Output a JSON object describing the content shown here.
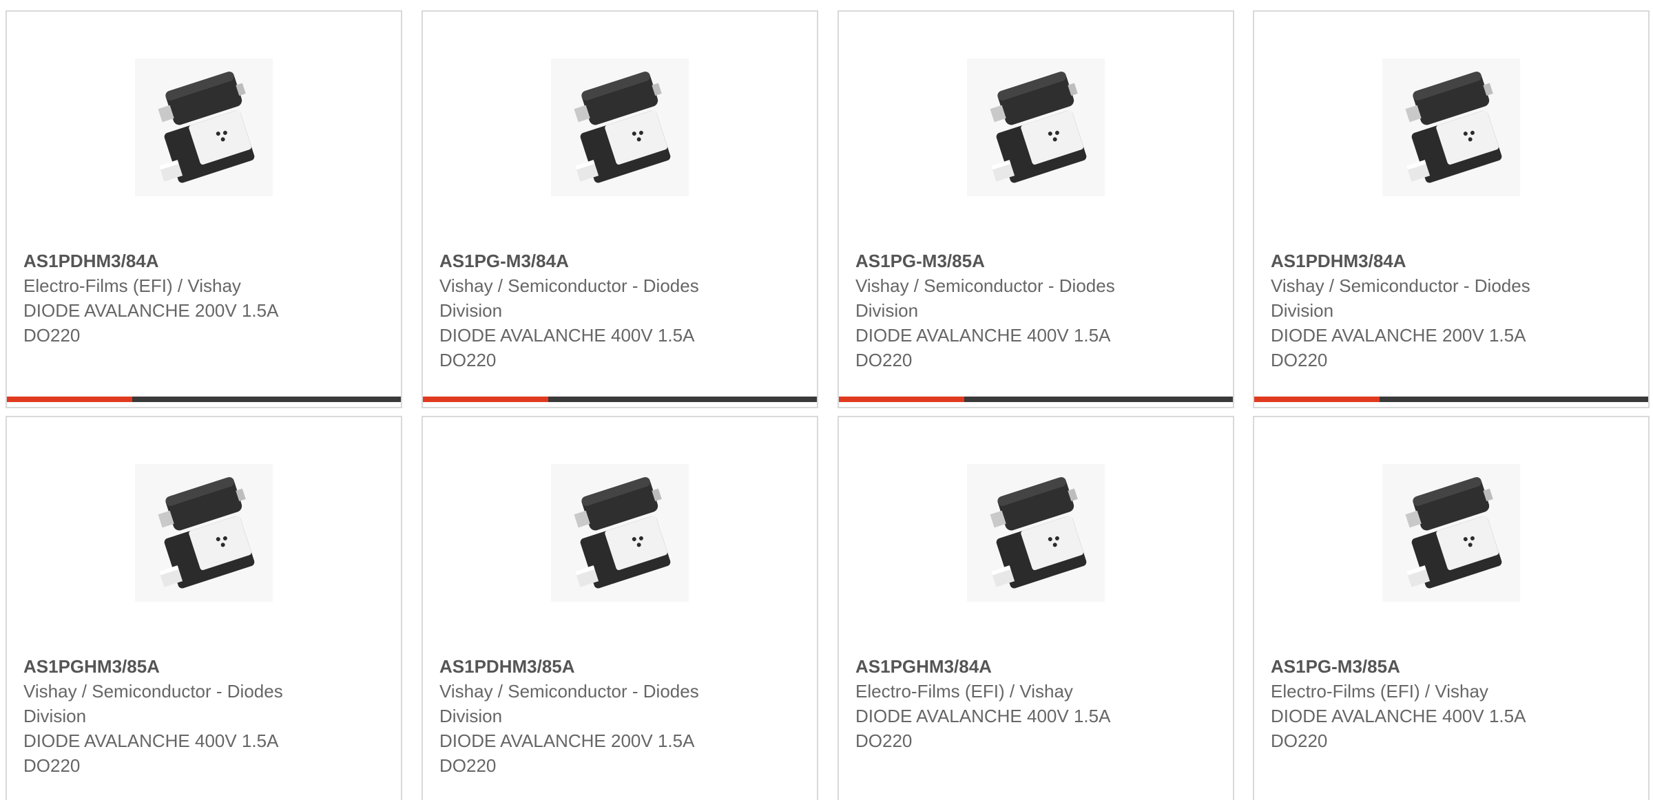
{
  "colors": {
    "accent": "#e03a1e",
    "bar": "#3a3a3a",
    "border": "#d9d9d9",
    "text": "#666666"
  },
  "products": [
    {
      "part_number": "AS1PDHM3/84A",
      "manufacturer": "Electro-Films (EFI) / Vishay",
      "description": "DIODE AVALANCHE 200V 1.5A",
      "package": "DO220",
      "image_icon": "diode-package-icon"
    },
    {
      "part_number": "AS1PG-M3/84A",
      "manufacturer": "Vishay / Semiconductor - Diodes Division",
      "description": "DIODE AVALANCHE 400V 1.5A",
      "package": "DO220",
      "image_icon": "diode-package-icon"
    },
    {
      "part_number": "AS1PG-M3/85A",
      "manufacturer": "Vishay / Semiconductor - Diodes Division",
      "description": "DIODE AVALANCHE 400V 1.5A",
      "package": "DO220",
      "image_icon": "diode-package-icon"
    },
    {
      "part_number": "AS1PDHM3/84A",
      "manufacturer": "Vishay / Semiconductor - Diodes Division",
      "description": "DIODE AVALANCHE 200V 1.5A",
      "package": "DO220",
      "image_icon": "diode-package-icon"
    },
    {
      "part_number": "AS1PGHM3/85A",
      "manufacturer": "Vishay / Semiconductor - Diodes Division",
      "description": "DIODE AVALANCHE 400V 1.5A",
      "package": "DO220",
      "image_icon": "diode-package-icon"
    },
    {
      "part_number": "AS1PDHM3/85A",
      "manufacturer": "Vishay / Semiconductor - Diodes Division",
      "description": "DIODE AVALANCHE 200V 1.5A",
      "package": "DO220",
      "image_icon": "diode-package-icon"
    },
    {
      "part_number": "AS1PGHM3/84A",
      "manufacturer": "Electro-Films (EFI) / Vishay",
      "description": "DIODE AVALANCHE 400V 1.5A",
      "package": "DO220",
      "image_icon": "diode-package-icon"
    },
    {
      "part_number": "AS1PG-M3/85A",
      "manufacturer": "Electro-Films (EFI) / Vishay",
      "description": "DIODE AVALANCHE 400V 1.5A",
      "package": "DO220",
      "image_icon": "diode-package-icon"
    }
  ]
}
